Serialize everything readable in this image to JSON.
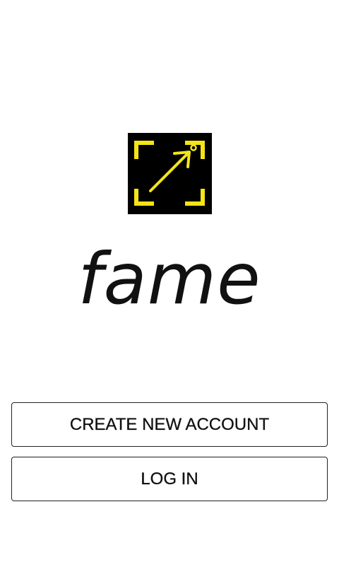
{
  "app": {
    "name": "fame",
    "logo_icon": "expand-arrow-frame-icon",
    "accent_color": "#f5e415"
  },
  "actions": {
    "create_account_label": "CREATE NEW ACCOUNT",
    "login_label": "LOG IN"
  }
}
